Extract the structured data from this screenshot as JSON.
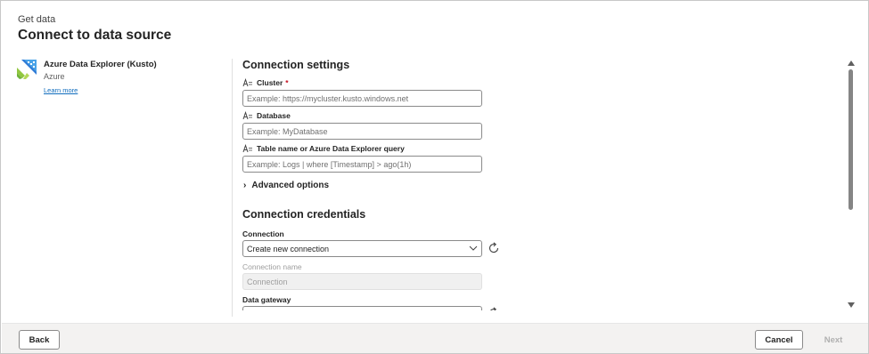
{
  "header": {
    "subtitle": "Get data",
    "title": "Connect to data source"
  },
  "source": {
    "icon": "azure-data-explorer-logo",
    "name": "Azure Data Explorer (Kusto)",
    "category": "Azure",
    "learn_more": "Learn more"
  },
  "settings": {
    "title": "Connection settings",
    "cluster": {
      "label": "Cluster",
      "required_mark": "*",
      "placeholder": "Example: https://mycluster.kusto.windows.net",
      "value": ""
    },
    "database": {
      "label": "Database",
      "placeholder": "Example: MyDatabase",
      "value": ""
    },
    "table": {
      "label": "Table name or Azure Data Explorer query",
      "placeholder": "Example: Logs | where [Timestamp] > ago(1h)",
      "value": ""
    },
    "advanced": "Advanced options"
  },
  "credentials": {
    "title": "Connection credentials",
    "connection": {
      "label": "Connection",
      "selected": "Create new connection"
    },
    "connection_name": {
      "label": "Connection name",
      "placeholder": "Connection",
      "disabled": true
    },
    "data_gateway": {
      "label": "Data gateway"
    }
  },
  "footer": {
    "back": "Back",
    "cancel": "Cancel",
    "next": "Next"
  },
  "colors": {
    "accent": "#0f6cbd",
    "required": "#c50f1f",
    "footer_bg": "#f3f2f1",
    "disabled_text": "#b0b0b0"
  }
}
